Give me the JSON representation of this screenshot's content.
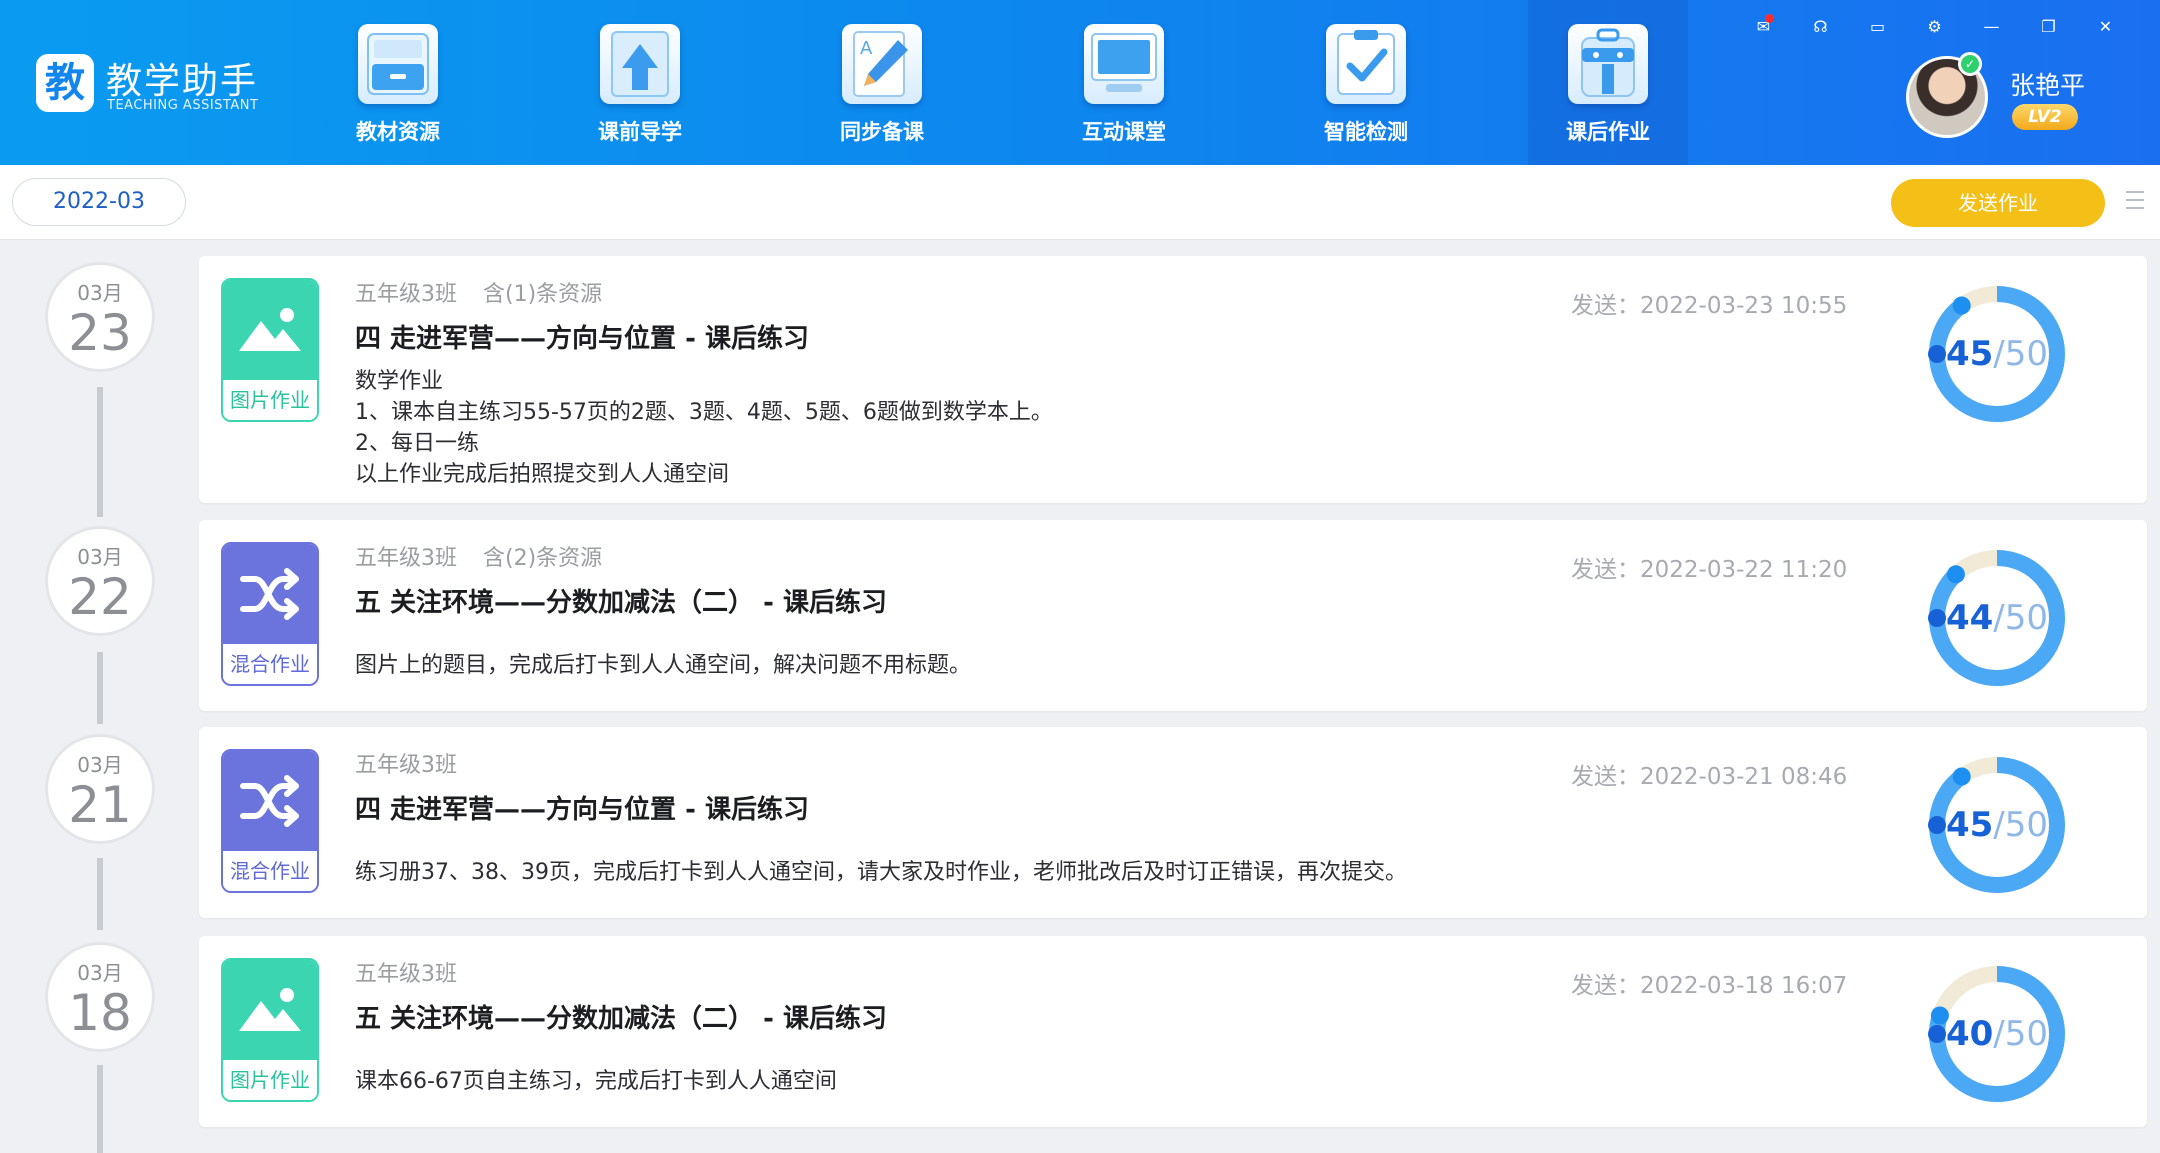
{
  "app": {
    "logo_char": "教",
    "title": "教学助手",
    "subtitle": "TEACHING ASSISTANT"
  },
  "nav": [
    {
      "label": "教材资源",
      "icon": "drawer-cabinet-icon"
    },
    {
      "label": "课前导学",
      "icon": "upload-arrow-icon"
    },
    {
      "label": "同步备课",
      "icon": "pencil-document-icon"
    },
    {
      "label": "互动课堂",
      "icon": "monitor-icon"
    },
    {
      "label": "智能检测",
      "icon": "checklist-icon"
    },
    {
      "label": "课后作业",
      "icon": "backpack-icon",
      "active": true
    }
  ],
  "window_controls": [
    "mail-icon",
    "headset-icon",
    "chat-icon",
    "settings-icon",
    "minimize-icon",
    "restore-icon",
    "close-icon"
  ],
  "user": {
    "name": "张艳平",
    "level": "LV2"
  },
  "toolbar": {
    "month": "2022-03",
    "send_button": "发送作业"
  },
  "colors": {
    "header": "#0d86ee",
    "accent": "#f4bf17",
    "image_type": "#3bd6b1",
    "mixed_type": "#6b74dd",
    "ring": "#4aa8f5"
  },
  "assignments": [
    {
      "month": "03月",
      "day": "23",
      "type": "img",
      "type_label": "图片作业",
      "class_name": "五年级3班",
      "resources": "含(1)条资源",
      "title": "四 走进军营——方向与位置 - 课后练习",
      "desc": [
        "数学作业",
        "1、课本自主练习55-57页的2题、3题、4题、5题、6题做到数学本上。",
        "2、每日一练",
        "以上作业完成后拍照提交到人人通空间"
      ],
      "sent": "发送：2022-03-23 10:55",
      "done": 45,
      "total": 50,
      "done_label": "45",
      "total_label": "/50"
    },
    {
      "month": "03月",
      "day": "22",
      "type": "mix",
      "type_label": "混合作业",
      "class_name": "五年级3班",
      "resources": "含(2)条资源",
      "title": "五 关注环境——分数加减法（二） - 课后练习",
      "desc": [
        "图片上的题目，完成后打卡到人人通空间，解决问题不用标题。"
      ],
      "sent": "发送：2022-03-22 11:20",
      "done": 44,
      "total": 50,
      "done_label": "44",
      "total_label": "/50"
    },
    {
      "month": "03月",
      "day": "21",
      "type": "mix",
      "type_label": "混合作业",
      "class_name": "五年级3班",
      "resources": "",
      "title": "四 走进军营——方向与位置 - 课后练习",
      "desc": [
        "练习册37、38、39页，完成后打卡到人人通空间，请大家及时作业，老师批改后及时订正错误，再次提交。"
      ],
      "sent": "发送：2022-03-21 08:46",
      "done": 45,
      "total": 50,
      "done_label": "45",
      "total_label": "/50"
    },
    {
      "month": "03月",
      "day": "18",
      "type": "img",
      "type_label": "图片作业",
      "class_name": "五年级3班",
      "resources": "",
      "title": "五 关注环境——分数加减法（二） - 课后练习",
      "desc": [
        "课本66-67页自主练习，完成后打卡到人人通空间"
      ],
      "sent": "发送：2022-03-18 16:07",
      "done": 40,
      "total": 50,
      "done_label": "40",
      "total_label": "/50"
    }
  ]
}
